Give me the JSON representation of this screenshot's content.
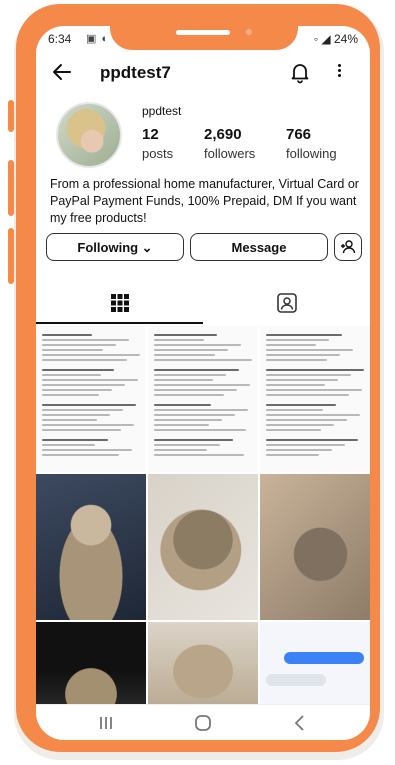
{
  "status_bar": {
    "time": "6:34",
    "left_icons": "▣ ◐ ▪ ▣ ▬ •",
    "right": "◦ ◢ 24%"
  },
  "header": {
    "username": "ppdtest7",
    "icons": [
      "back-arrow-icon",
      "bell-icon",
      "more-vertical-icon"
    ]
  },
  "profile": {
    "display_name": "ppdtest",
    "stats": [
      {
        "num": "12",
        "label": "posts"
      },
      {
        "num": "2,690",
        "label": "followers"
      },
      {
        "num": "766",
        "label": "following"
      }
    ],
    "bio": "From a professional home manufacturer, Virtual Card or PayPal Payment Funds, 100% Prepaid, DM If you want my free products!"
  },
  "actions": {
    "following_label": "Following ⌄",
    "message_label": "Message",
    "add_icon": "add-person-icon"
  },
  "tabs": [
    "grid-icon",
    "tagged-icon"
  ],
  "theme": {
    "frame": "#f5894a",
    "accent": "#1a73e8"
  },
  "nav": [
    "recent-apps-icon",
    "home-icon",
    "back-icon"
  ]
}
